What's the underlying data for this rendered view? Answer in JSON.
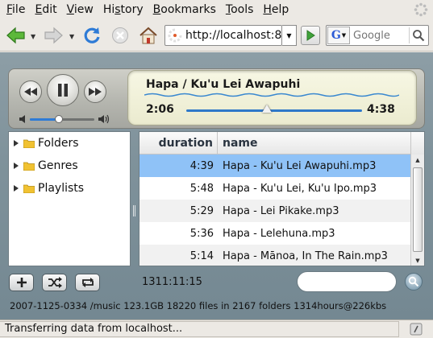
{
  "menu": [
    "File",
    "Edit",
    "View",
    "History",
    "Bookmarks",
    "Tools",
    "Help"
  ],
  "menu_accel": [
    "F",
    "E",
    "V",
    "s",
    "B",
    "T",
    "H"
  ],
  "url": "http://localhost:8",
  "search_placeholder": "Google",
  "player": {
    "now_playing": "Hapa / Ku'u Lei Awapuhi",
    "elapsed": "2:06",
    "total": "4:38",
    "progress": 0.46,
    "volume": 0.45
  },
  "tree": [
    {
      "label": "Folders"
    },
    {
      "label": "Genres"
    },
    {
      "label": "Playlists"
    }
  ],
  "columns": {
    "duration": "duration",
    "name": "name"
  },
  "tracks": [
    {
      "duration": "4:39",
      "name": "Hapa - Ku'u Lei Awapuhi.mp3",
      "selected": true
    },
    {
      "duration": "5:48",
      "name": "Hapa - Ku'u Lei, Ku'u Ipo.mp3",
      "selected": false
    },
    {
      "duration": "5:29",
      "name": "Hapa - Lei Pikake.mp3",
      "selected": false
    },
    {
      "duration": "5:36",
      "name": "Hapa - Lelehuna.mp3",
      "selected": false
    },
    {
      "duration": "5:14",
      "name": "Hapa - Mānoa, In The Rain.mp3",
      "selected": false
    }
  ],
  "total_time": "1311:11:15",
  "stats": "2007-1125-0334 /music 123.1GB  18220 files in 2167 folders  1314hours@226kbs",
  "status": "Transferring data from localhost...",
  "colors": {
    "selection": "#8fc2f7",
    "accent": "#2f78c9",
    "panel": "#7f929b"
  }
}
